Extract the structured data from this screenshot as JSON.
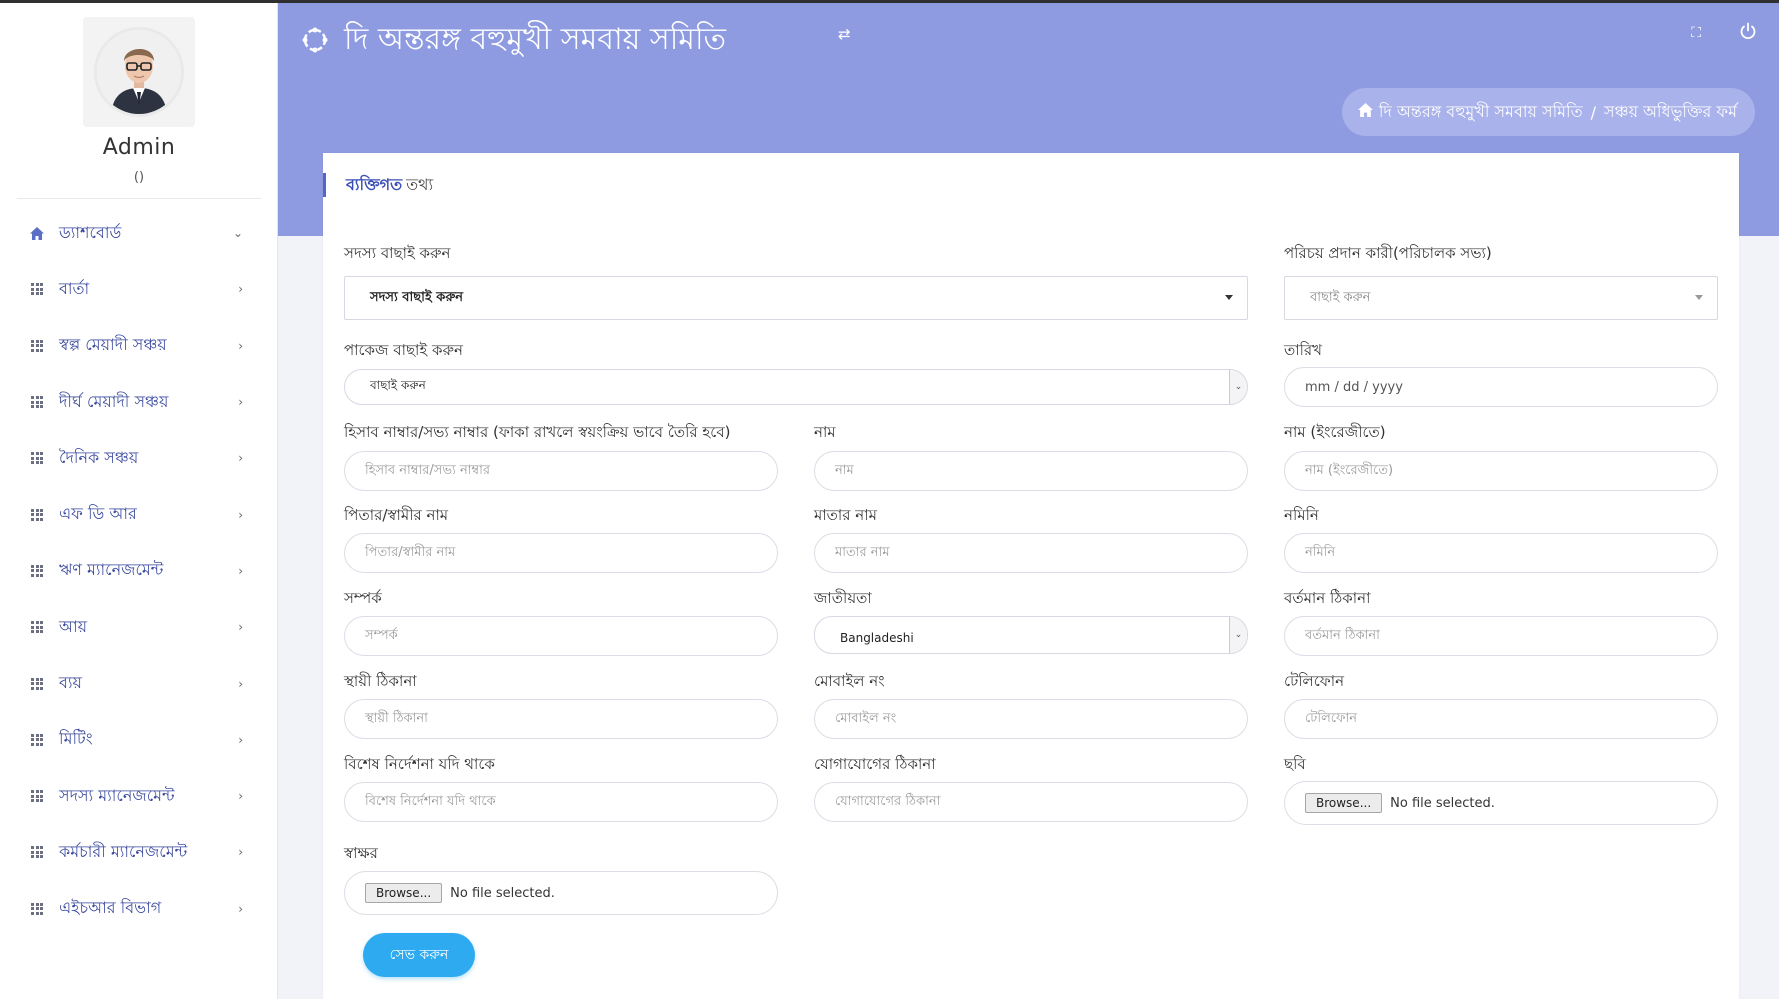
{
  "user": {
    "name": "Admin",
    "sub": "()"
  },
  "sidebar": {
    "items": [
      {
        "label": "ড্যাশবোর্ড",
        "icon": "home-icon",
        "chevron": "⌄"
      },
      {
        "label": "বার্তা",
        "icon": "grid-icon",
        "chevron": "›"
      },
      {
        "label": "স্বল্প মেয়াদী সঞ্চয়",
        "icon": "grid-icon",
        "chevron": "›"
      },
      {
        "label": "দীর্ঘ মেয়াদী সঞ্চয়",
        "icon": "grid-icon",
        "chevron": "›"
      },
      {
        "label": "দৈনিক সঞ্চয়",
        "icon": "grid-icon",
        "chevron": "›"
      },
      {
        "label": "এফ ডি আর",
        "icon": "grid-icon",
        "chevron": "›"
      },
      {
        "label": "ঋণ ম্যানেজমেন্ট",
        "icon": "grid-icon",
        "chevron": "›"
      },
      {
        "label": "আয়",
        "icon": "grid-icon",
        "chevron": "›"
      },
      {
        "label": "ব্যয়",
        "icon": "grid-icon",
        "chevron": "›"
      },
      {
        "label": "মিটিং",
        "icon": "grid-icon",
        "chevron": "›"
      },
      {
        "label": "সদস্য ম্যানেজমেন্ট",
        "icon": "grid-icon",
        "chevron": "›"
      },
      {
        "label": "কর্মচারী ম্যানেজমেন্ট",
        "icon": "grid-icon",
        "chevron": "›"
      },
      {
        "label": "এইচআর বিভাগ",
        "icon": "grid-icon",
        "chevron": "›"
      }
    ]
  },
  "header": {
    "title": "দি অন্তরঙ্গ বহুমুখী সমবায় সমিতি"
  },
  "breadcrumb": {
    "home": "দি অন্তরঙ্গ বহুমুখী সমবায় সমিতি",
    "separator": "/",
    "current": "সঞ্চয় অধিভুক্তির ফর্ম"
  },
  "card": {
    "title_accent": "ব্যক্তিগত",
    "title_rest": "তথ্য"
  },
  "form": {
    "member_select": {
      "label": "সদস্য বাছাই করুন",
      "value": "সদস্য বাছাই করুন"
    },
    "introducer": {
      "label": "পরিচয় প্রদান কারী(পরিচালক সভ্য)",
      "value": "বাছাই করুন"
    },
    "package": {
      "label": "পাকেজ বাছাই করুন",
      "value": "বাছাই করুন"
    },
    "date": {
      "label": "তারিখ",
      "placeholder": "mm / dd / yyyy"
    },
    "account_no": {
      "label": "হিসাব নাম্বার/সভ্য নাম্বার (ফাকা রাখলে স্বয়ংক্রিয় ভাবে তৈরি হবে)",
      "placeholder": "হিসাব নাম্বার/সভ্য নাম্বার"
    },
    "name": {
      "label": "নাম",
      "placeholder": "নাম"
    },
    "name_en": {
      "label": "নাম (ইংরেজীতে)",
      "placeholder": "নাম (ইংরেজীতে)"
    },
    "father": {
      "label": "পিতার/স্বামীর নাম",
      "placeholder": "পিতার/স্বামীর নাম"
    },
    "mother": {
      "label": "মাতার নাম",
      "placeholder": "মাতার নাম"
    },
    "nominee": {
      "label": "নমিনি",
      "placeholder": "নমিনি"
    },
    "relation": {
      "label": "সম্পর্ক",
      "placeholder": "সম্পর্ক"
    },
    "nationality": {
      "label": "জাতীয়তা",
      "value": "Bangladeshi"
    },
    "present_address": {
      "label": "বর্তমান ঠিকানা",
      "placeholder": "বর্তমান ঠিকানা"
    },
    "permanent_address": {
      "label": "স্থায়ী ঠিকানা",
      "placeholder": "স্থায়ী ঠিকানা"
    },
    "mobile": {
      "label": "মোবাইল নং",
      "placeholder": "মোবাইল নং"
    },
    "telephone": {
      "label": "টেলিফোন",
      "placeholder": "টেলিফোন"
    },
    "special_note": {
      "label": "বিশেষ নির্দেশনা যদি থাকে",
      "placeholder": "বিশেষ নির্দেশনা যদি থাকে"
    },
    "contact_address": {
      "label": "যোগাযোগের ঠিকানা",
      "placeholder": "যোগাযোগের ঠিকানা"
    },
    "photo": {
      "label": "ছবি",
      "button": "Browse...",
      "status": "No file selected."
    },
    "signature": {
      "label": "স্বাক্ষর",
      "button": "Browse...",
      "status": "No file selected."
    },
    "save": "সেভ করুন"
  }
}
